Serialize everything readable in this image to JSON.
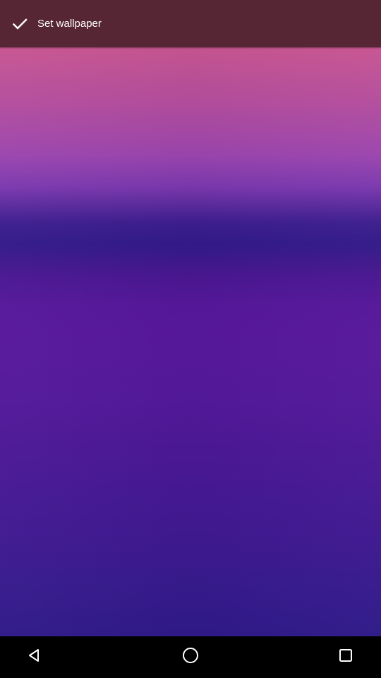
{
  "action_bar": {
    "set_wallpaper_label": "Set wallpaper",
    "icon": "check-icon",
    "background_color": "#572634"
  },
  "wallpaper": {
    "type": "gradient",
    "colors": [
      "#d95b8c",
      "#9b45ae",
      "#311a89",
      "#57189b",
      "#2e1a89"
    ]
  },
  "navigation_bar": {
    "buttons": [
      {
        "icon": "back-icon"
      },
      {
        "icon": "home-icon"
      },
      {
        "icon": "recents-icon"
      }
    ]
  }
}
